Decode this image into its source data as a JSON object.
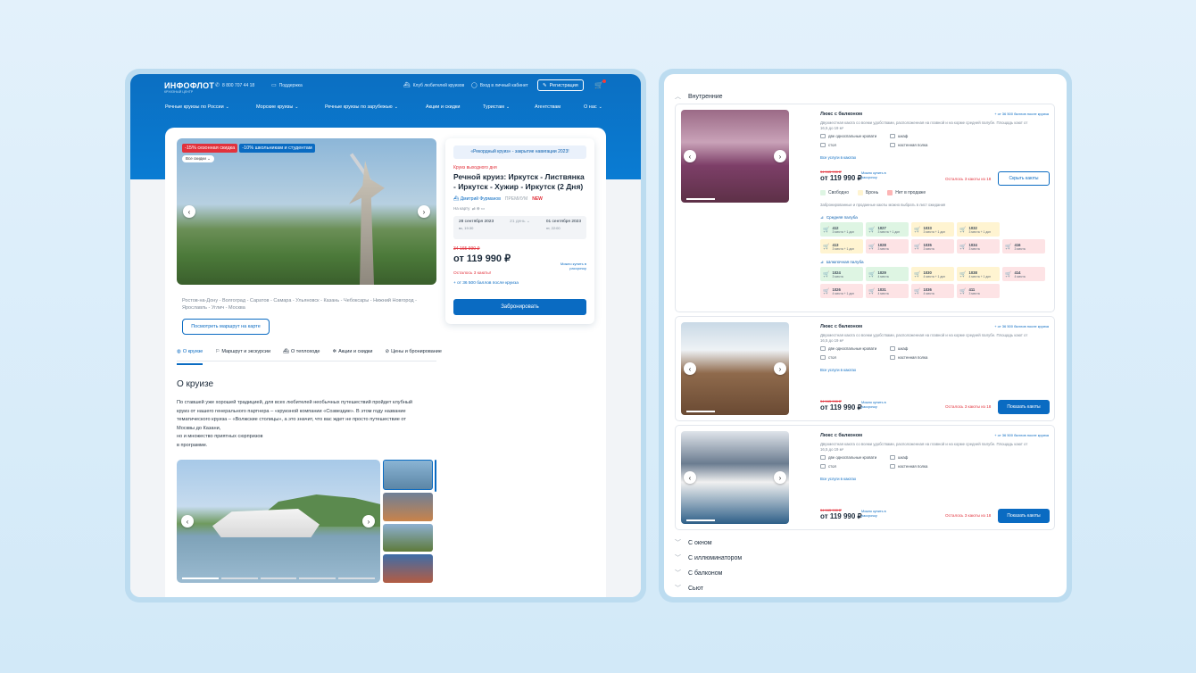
{
  "left": {
    "header": {
      "logo": "ИНФОФЛОТ",
      "logo_sub": "КРУИЗНЫЙ ЦЕНТР",
      "phone": "8 800 707 44 18",
      "support": "Поддержка",
      "club": "Клуб любителей круизов",
      "cabinet": "Вход в личный кабинет",
      "register": "Регистрация",
      "nav": [
        "Речные круизы по России",
        "Морские круизы",
        "Речные круизы по зарубежью",
        "Акции и скидки",
        "Туристам",
        "Агентствам",
        "О нас"
      ]
    },
    "photo": {
      "badge_sale": "-15% сезонная скидка",
      "badge_school": "-10% школьникам и студентам",
      "all_sales": "Все скидки"
    },
    "route": "Ростов-на-Дону - Волгоград - Саратов - Самара - Ульяновск - Казань - Чебоксары - Нижний Новгород - Ярославль - Углич - Москва",
    "map_button": "Посмотреть маршрут на карте",
    "tabs": [
      "О круизе",
      "Маршрут и экскурсии",
      "О теплоходе",
      "Акции и скидки",
      "Цены и бронирование"
    ],
    "about_title": "О круизе",
    "about_text": [
      "По ставшей уже хорошей традицией, для всех любителей необычных путешествий пройдет клубный",
      "круиз от нашего генерального партнера – «круизной компании «Созвездие». В этом году название",
      "тематического круиза – «Волжские столицы», а это значит, что вас ждет не просто путешествие от",
      "Москвы до Казани,",
      "но и множество приятных сюрпризов",
      "в программе."
    ],
    "booking": {
      "record": "«Рекордный круиз» - закрытие навигации 2023!",
      "kind": "Круиз выходного дня",
      "title": "Речной круиз: Иркутск - Листвянка - Иркутск - Хужир - Иркутск (2 Дня)",
      "ship": "Дмитрий Фурманов",
      "premium": "ПРЕМИУМ",
      "new": "NEW",
      "onmap": "На карту",
      "date_from": "28 сентября 2023",
      "time_from": "вс, 19:30",
      "duration": "21 день",
      "date_to": "01 сентября 2023",
      "time_to": "пт, 22:00",
      "old_price": "34 165 990 ₽",
      "price": "от 119 990 ₽",
      "installment": "Можно купить в рассрочку",
      "left": "Осталось 3 каюты!",
      "points": "+ от 36 500 баллов после круиза",
      "book_btn": "Забронировать"
    }
  },
  "right": {
    "section": "Внутренние",
    "cards": [
      {
        "title": "Люкс с балконом",
        "bonus": "+ от 36 500 баллов после круиза",
        "desc": "Двухместная каюта со всеми удобствами, расположенная на главной и на корме средней палубе. Площадь кают от 16,5 до 19 м²",
        "amenities": [
          "две односпальные кровати",
          "шкаф",
          "стол",
          "настенная полка"
        ],
        "all_services": "Все услуги в каютах",
        "old_price": "34 165 990 ₽",
        "price": "от 119 990 ₽",
        "installment": "Можно купить в рассрочку",
        "left": "Осталось 3 каюты из 18",
        "button": "Скрыть каюты"
      },
      {
        "title": "Люкс с балконом",
        "bonus": "+ от 36 500 баллов после круиза",
        "desc": "Двухместная каюта со всеми удобствами, расположенная на главной и на корме средней палубе. Площадь кают от 16,5 до 19 м²",
        "amenities": [
          "две односпальные кровати",
          "шкаф",
          "стол",
          "настенная полка"
        ],
        "all_services": "Все услуги в каютах",
        "old_price": "34 165 990 ₽",
        "price": "от 119 990 ₽",
        "installment": "Можно купить в рассрочку",
        "left": "Осталось 3 каюты из 18",
        "button": "Показать каюты"
      },
      {
        "title": "Люкс с балконом",
        "bonus": "+ от 36 500 баллов после круиза",
        "desc": "Двухместная каюта со всеми удобствами, расположенная на главной и на корме средней палубе. Площадь кают от 16,5 до 19 м²",
        "amenities": [
          "две односпальные кровати",
          "шкаф",
          "стол",
          "настенная полка"
        ],
        "all_services": "Все услуги в каютах",
        "old_price": "34 165 990 ₽",
        "price": "от 119 990 ₽",
        "installment": "Можно купить в рассрочку",
        "left": "Осталось 3 каюты из 18",
        "button": "Показать каюты"
      }
    ],
    "legend": [
      "Свободно",
      "Бронь",
      "Нет в продаже"
    ],
    "note": "Забронированные и проданные каюты можно выбрать в лист ожидания",
    "deck1": "Средняя палуба",
    "deck2": "Шлюпочная палуба",
    "cabins1": [
      {
        "n": "412",
        "s": "3 места + 1 доп"
      },
      {
        "n": "1027",
        "s": "3 места + 1 доп"
      },
      {
        "n": "1033",
        "s": "3 места + 1 доп"
      },
      {
        "n": "1032",
        "s": "3 места + 1 доп"
      },
      {
        "n": "",
        "s": ""
      },
      {
        "n": "413",
        "s": "3 места + 1 доп"
      },
      {
        "n": "1028",
        "s": "3 места"
      },
      {
        "n": "1035",
        "s": "3 места"
      },
      {
        "n": "1034",
        "s": "3 места"
      },
      {
        "n": "416",
        "s": "3 места"
      }
    ],
    "cabins2": [
      {
        "n": "1024",
        "s": "3 места"
      },
      {
        "n": "1029",
        "s": "4 места"
      },
      {
        "n": "1030",
        "s": "4 места + 1 доп"
      },
      {
        "n": "1038",
        "s": "4 места + 1 доп"
      },
      {
        "n": "414",
        "s": "4 места"
      },
      {
        "n": "1026",
        "s": "4 места + 1 доп"
      },
      {
        "n": "1031",
        "s": "4 места"
      },
      {
        "n": "1036",
        "s": "4 места"
      },
      {
        "n": "411",
        "s": "3 места"
      },
      {
        "n": "",
        "s": ""
      }
    ],
    "collapsed": [
      "С окном",
      "С иллюминатором",
      "С балконом",
      "Сьют"
    ]
  },
  "colors": {
    "brand": "#0a6bc2",
    "accent_red": "#e2323c",
    "free": "#def5e3",
    "booked": "#fff4d1",
    "not_sale": "#fde3e5"
  }
}
